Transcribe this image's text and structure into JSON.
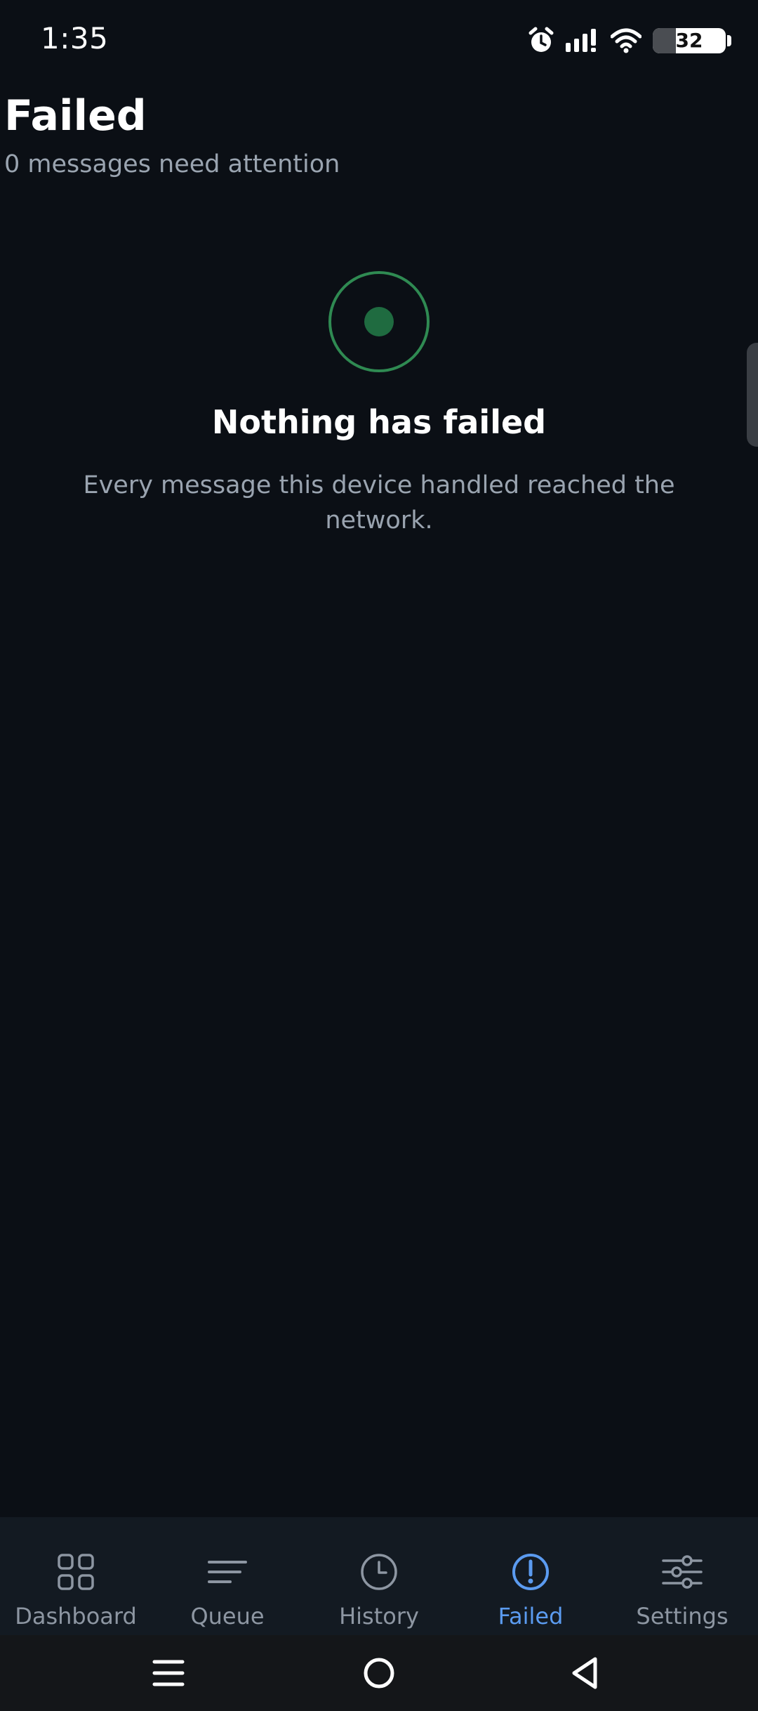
{
  "status_bar": {
    "time": "1:35",
    "battery_level": "32",
    "icons": [
      "alarm-icon",
      "signal-icon",
      "wifi-icon",
      "battery-icon"
    ]
  },
  "header": {
    "title": "Failed",
    "subtitle": "0 messages need attention"
  },
  "empty_state": {
    "icon": "status-dot-icon",
    "title": "Nothing has failed",
    "description": "Every message this device handled reached the network."
  },
  "bottom_nav": {
    "active": "Failed",
    "items": [
      {
        "label": "Dashboard",
        "icon": "grid-icon"
      },
      {
        "label": "Queue",
        "icon": "lines-icon"
      },
      {
        "label": "History",
        "icon": "clock-icon"
      },
      {
        "label": "Failed",
        "icon": "alert-circle-icon"
      },
      {
        "label": "Settings",
        "icon": "sliders-icon"
      }
    ]
  },
  "system_nav": {
    "buttons": [
      "menu-icon",
      "home-icon",
      "back-icon"
    ]
  },
  "colors": {
    "background": "#0b0f15",
    "nav_background": "#131a22",
    "accent": "#5b9bf0",
    "success": "#2f8a52",
    "muted_text": "#9aa4b0"
  }
}
